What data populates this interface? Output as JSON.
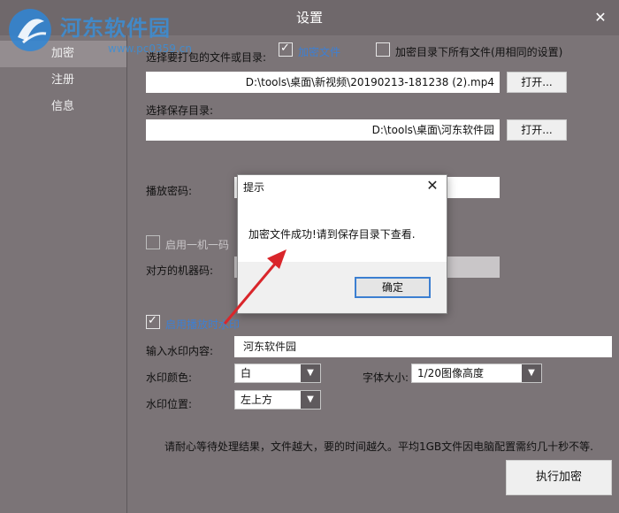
{
  "window": {
    "title": "设置",
    "close_glyph": "✕"
  },
  "watermark": {
    "site": "河东软件园",
    "url": "www.pc0359.cn"
  },
  "sidebar": {
    "items": [
      {
        "label": "加密",
        "active": true
      },
      {
        "label": "注册",
        "active": false
      },
      {
        "label": "信息",
        "active": false
      }
    ]
  },
  "form": {
    "select_source_label": "选择要打包的文件或目录:",
    "encrypt_file_label": "加密文件",
    "encrypt_dir_label": "加密目录下所有文件(用相同的设置)",
    "source_path": "D:\\tools\\桌面\\新视频\\20190213-181238 (2).mp4",
    "open_label": "打开...",
    "save_dir_label": "选择保存目录:",
    "save_path": "D:\\tools\\桌面\\河东软件园",
    "play_password_label": "播放密码:",
    "one_machine_label": "启用一机一码",
    "machine_code_label": "对方的机器码:",
    "watermark_enable_label": "启用播放时水印",
    "watermark_content_label": "输入水印内容:",
    "watermark_content": "河东软件园",
    "watermark_color_label": "水印颜色:",
    "watermark_color": "白",
    "font_size_label": "字体大小:",
    "font_size": "1/20图像高度",
    "watermark_pos_label": "水印位置:",
    "watermark_pos": "左上方",
    "note": "请耐心等待处理结果，文件越大，要的时间越久。平均1GB文件因电脑配置需约几十秒不等.",
    "execute_label": "执行加密",
    "check_glyph": "✓",
    "dropdown_glyph": "▼"
  },
  "dialog": {
    "title": "提示",
    "close_glyph": "✕",
    "message": "加密文件成功!请到保存目录下查看.",
    "ok_label": "确定"
  },
  "colors": {
    "accent": "#3c7fd1",
    "annotation_arrow": "#d9262b",
    "background": "#7b7477"
  }
}
